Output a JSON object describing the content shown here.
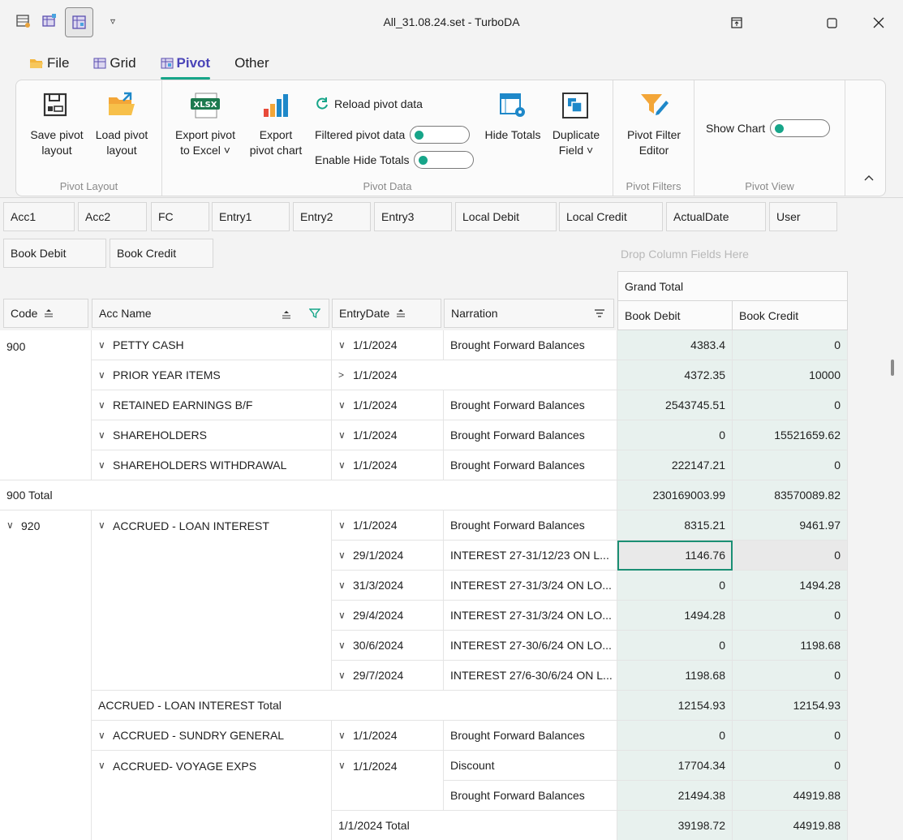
{
  "window": {
    "title": "All_31.08.24.set - TurboDA"
  },
  "ribbon_tabs": [
    {
      "label": "File",
      "icon": "folder-icon"
    },
    {
      "label": "Grid",
      "icon": "grid-icon"
    },
    {
      "label": "Pivot",
      "icon": "pivot-icon"
    },
    {
      "label": "Other",
      "icon": ""
    }
  ],
  "ribbon": {
    "pivot_layout": {
      "label": "Pivot Layout",
      "save": "Save pivot\nlayout",
      "load": "Load pivot\nlayout"
    },
    "pivot_data": {
      "label": "Pivot Data",
      "export_excel": "Export pivot\nto Excel ˅",
      "export_chart": "Export\npivot chart",
      "reload": "Reload pivot data",
      "filtered": "Filtered pivot data",
      "enable_hide": "Enable Hide Totals",
      "hide_totals": "Hide Totals",
      "duplicate": "Duplicate\nField ˅"
    },
    "pivot_filters": {
      "label": "Pivot Filters",
      "editor": "Pivot Filter\nEditor"
    },
    "pivot_view": {
      "label": "Pivot View",
      "show_chart": "Show Chart"
    }
  },
  "filter_fields": [
    "Acc1",
    "Acc2",
    "FC",
    "Entry1",
    "Entry2",
    "Entry3",
    "Local Debit",
    "Local Credit",
    "ActualDate",
    "User"
  ],
  "data_fields": [
    "Book Debit",
    "Book Credit"
  ],
  "drop_hint": "Drop Column Fields Here",
  "row_headers": [
    "Code",
    "Acc Name",
    "EntryDate",
    "Narration"
  ],
  "grand_total": "Grand Total",
  "column_values": [
    "Book Debit",
    "Book Credit"
  ],
  "rows": [
    {
      "code": "900",
      "acc": "PETTY CASH",
      "acc_chev": "∨",
      "date": "1/1/2024",
      "date_chev": "∨",
      "narr": "Brought Forward Balances",
      "debit": "4383.4",
      "credit": "0"
    },
    {
      "code": "",
      "acc": "PRIOR YEAR ITEMS",
      "acc_chev": "∨",
      "date": "1/1/2024",
      "date_chev": ">",
      "narr": "",
      "debit": "4372.35",
      "credit": "10000"
    },
    {
      "code": "",
      "acc": "RETAINED EARNINGS B/F",
      "acc_chev": "∨",
      "date": "1/1/2024",
      "date_chev": "∨",
      "narr": "Brought Forward Balances",
      "debit": "2543745.51",
      "credit": "0"
    },
    {
      "code": "",
      "acc": "SHAREHOLDERS",
      "acc_chev": "∨",
      "date": "1/1/2024",
      "date_chev": "∨",
      "narr": "Brought Forward Balances",
      "debit": "0",
      "credit": "15521659.62"
    },
    {
      "code": "",
      "acc": "SHAREHOLDERS WITHDRAWAL",
      "acc_chev": "∨",
      "date": "1/1/2024",
      "date_chev": "∨",
      "narr": "Brought Forward Balances",
      "debit": "222147.21",
      "credit": "0"
    }
  ],
  "total_900": {
    "label": "900 Total",
    "debit": "230169003.99",
    "credit": "83570089.82"
  },
  "group_920": {
    "code": "920",
    "acc": "ACCRUED - LOAN INTEREST",
    "rows": [
      {
        "date": "1/1/2024",
        "narr": "Brought Forward Balances",
        "debit": "8315.21",
        "credit": "9461.97"
      },
      {
        "date": "29/1/2024",
        "narr": "INTEREST 27-31/12/23 ON L...",
        "debit": "1146.76",
        "credit": "0"
      },
      {
        "date": "31/3/2024",
        "narr": "INTEREST 27-31/3/24 ON LO...",
        "debit": "0",
        "credit": "1494.28"
      },
      {
        "date": "29/4/2024",
        "narr": "INTEREST 27-31/3/24 ON LO...",
        "debit": "1494.28",
        "credit": "0"
      },
      {
        "date": "30/6/2024",
        "narr": "INTEREST 27-30/6/24 ON LO...",
        "debit": "0",
        "credit": "1198.68"
      },
      {
        "date": "29/7/2024",
        "narr": "INTEREST 27/6-30/6/24 ON L...",
        "debit": "1198.68",
        "credit": "0"
      }
    ],
    "acc_total": {
      "label": "ACCRUED - LOAN INTEREST Total",
      "debit": "12154.93",
      "credit": "12154.93"
    },
    "sundry": {
      "acc": "ACCRUED - SUNDRY GENERAL",
      "date": "1/1/2024",
      "narr": "Brought Forward Balances",
      "debit": "0",
      "credit": "0"
    },
    "voyage": {
      "acc": "ACCRUED- VOYAGE EXPS",
      "date": "1/1/2024",
      "rows": [
        {
          "narr": "Discount",
          "debit": "17704.34",
          "credit": "0"
        },
        {
          "narr": "Brought Forward Balances",
          "debit": "21494.38",
          "credit": "44919.88"
        }
      ],
      "date_total": {
        "label": "1/1/2024 Total",
        "debit": "39198.72",
        "credit": "44919.88"
      }
    }
  },
  "colors": {
    "accent": "#17a589",
    "tab_active": "#4a44b8",
    "value_bg": "#e8f1ee"
  }
}
